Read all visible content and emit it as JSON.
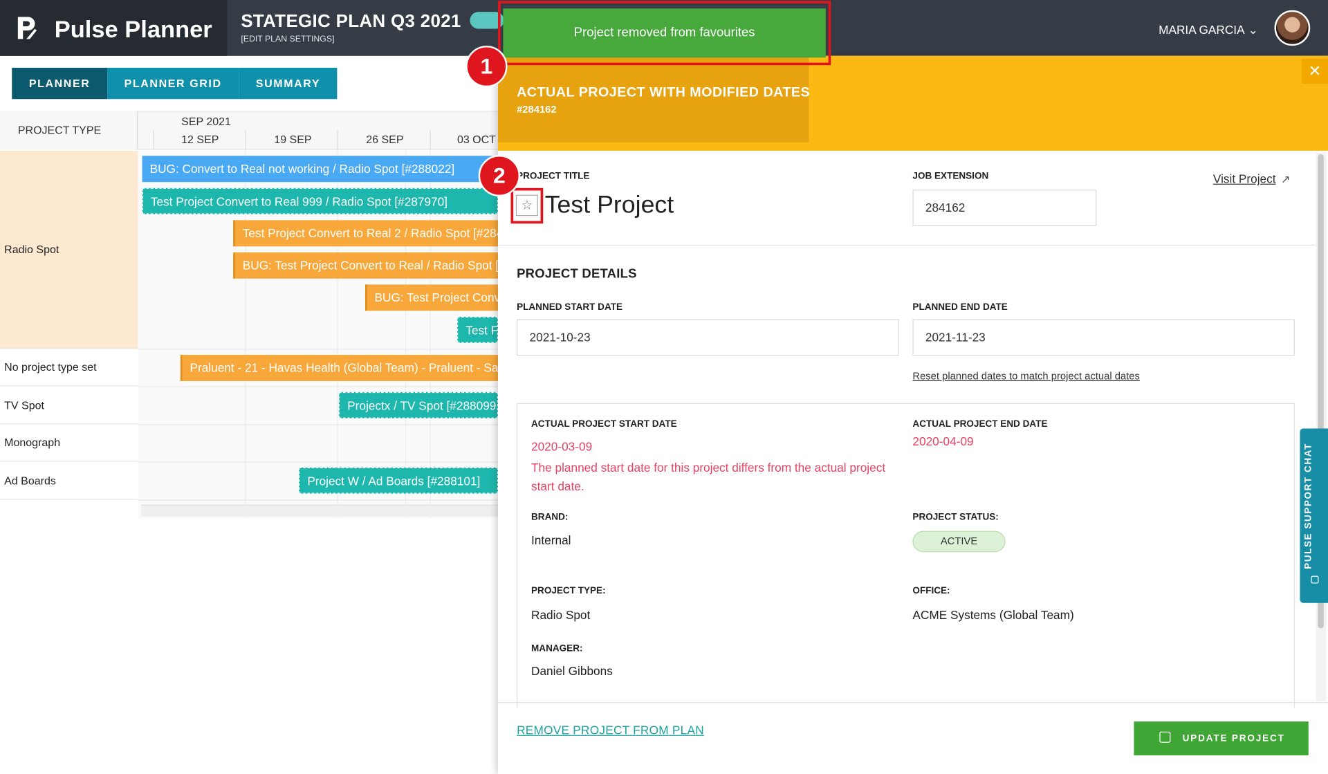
{
  "app": {
    "name": "Pulse Planner",
    "plan_title": "STATEGIC PLAN Q3 2021",
    "plan_settings": "[EDIT PLAN SETTINGS]",
    "user_name": "MARIA GARCIA"
  },
  "tabs": [
    {
      "label": "PLANNER",
      "active": true
    },
    {
      "label": "PLANNER GRID",
      "active": false
    },
    {
      "label": "SUMMARY",
      "active": false
    }
  ],
  "grid": {
    "project_type_header": "PROJECT TYPE",
    "month": "SEP 2021",
    "weeks": [
      "12 SEP",
      "19 SEP",
      "26 SEP",
      "03 OCT"
    ],
    "rows": [
      {
        "label": "Radio Spot"
      },
      {
        "label": "No project type set"
      },
      {
        "label": "TV Spot"
      },
      {
        "label": "Monograph"
      },
      {
        "label": "Ad Boards"
      }
    ],
    "bars": [
      {
        "label": "BUG: Convert to Real not working / Radio Spot [#288022]",
        "color": "blue"
      },
      {
        "label": "Test Project Convert to Real 999 / Radio Spot [#287970]",
        "color": "teal"
      },
      {
        "label": "Test Project Convert to Real 2 / Radio Spot [#284",
        "color": "orange"
      },
      {
        "label": "BUG: Test Project Convert to Real / Radio Spot [#",
        "color": "orange"
      },
      {
        "label": "BUG: Test Project Conve",
        "color": "orange"
      },
      {
        "label": "Test Fa",
        "color": "teal"
      },
      {
        "label": "Praluent - 21 - Havas Health (Global Team) - Praluent - Sanc",
        "color": "orange"
      },
      {
        "label": "Projectx / TV Spot [#288099",
        "color": "teal"
      },
      {
        "label": "Project W / Ad Boards [#288101]",
        "color": "teal"
      }
    ]
  },
  "panel": {
    "header_title": "ACTUAL PROJECT WITH MODIFIED DATES",
    "header_number": "#284162",
    "project_title_label": "PROJECT TITLE",
    "project_title": "Test Project",
    "job_extension_label": "JOB EXTENSION",
    "job_extension": "284162",
    "visit_link": "Visit Project",
    "section_title": "PROJECT DETAILS",
    "planned_start_label": "PLANNED START DATE",
    "planned_start": "2021-10-23",
    "planned_end_label": "PLANNED END DATE",
    "planned_end": "2021-11-23",
    "reset_link": "Reset planned dates to match project actual dates",
    "actual_start_label": "ACTUAL PROJECT START DATE",
    "actual_start": "2020-03-09",
    "actual_start_warning": "The planned start date for this project differs from the actual project start date.",
    "actual_end_label": "ACTUAL PROJECT END DATE",
    "actual_end": "2020-04-09",
    "brand_label": "BRAND:",
    "brand": "Internal",
    "status_label": "PROJECT STATUS:",
    "status": "ACTIVE",
    "type_label": "PROJECT TYPE:",
    "type": "Radio Spot",
    "office_label": "OFFICE:",
    "office": "ACME Systems (Global Team)",
    "manager_label": "MANAGER:",
    "manager": "Daniel Gibbons",
    "remove_link": "REMOVE PROJECT FROM PLAN",
    "update_button": "UPDATE PROJECT"
  },
  "chat_tab": "PULSE SUPPORT CHAT",
  "toast": "Project removed from favourites",
  "annotations": {
    "marker_1": "1",
    "marker_2": "2"
  },
  "colors": {
    "header_dark": "#353c45",
    "tab_active": "#0b5a6e",
    "tab_inactive": "#0f91ac",
    "panel_header": "#fdb913",
    "toast_green": "#47a93b",
    "update_green": "#3fa534",
    "annotation_red": "#e0161f",
    "date_warning_red": "#e84263"
  }
}
